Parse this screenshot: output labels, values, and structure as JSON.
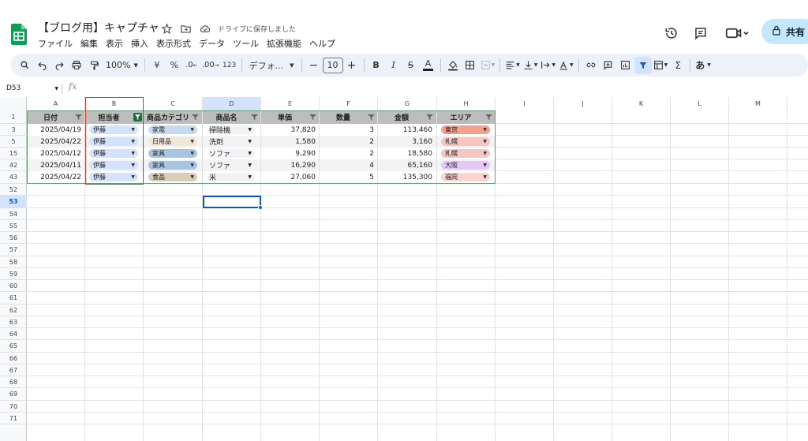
{
  "header": {
    "title": "【ブログ用】キャプチャ",
    "saved_status": "ドライブに保存しました",
    "share_label": "共有",
    "menu": [
      "ファイル",
      "編集",
      "表示",
      "挿入",
      "表示形式",
      "データ",
      "ツール",
      "拡張機能",
      "ヘルプ"
    ],
    "icons": [
      "star-icon",
      "move-to-folder-icon",
      "cloud-saved-icon",
      "history-icon",
      "comments-icon",
      "meet-icon",
      "lock-icon"
    ]
  },
  "toolbar": {
    "zoom": "100%",
    "currency": "¥",
    "percent": "%",
    "decrease_decimal": ".0",
    "increase_decimal": ".00",
    "number_format": "123",
    "font_family": "デフォ...",
    "font_size": "10",
    "ime": "あ"
  },
  "formula_bar": {
    "cell_ref": "D53",
    "fx": "fx",
    "value": ""
  },
  "grid": {
    "columns": [
      "A",
      "B",
      "C",
      "D",
      "E",
      "F",
      "G",
      "H",
      "I",
      "J",
      "K",
      "L",
      "M"
    ],
    "row_numbers": [
      "1",
      "3",
      "5",
      "15",
      "42",
      "43",
      "52",
      "53",
      "54",
      "55",
      "56",
      "57",
      "58",
      "59",
      "60",
      "61",
      "62",
      "63",
      "64",
      "65",
      "66",
      "67",
      "68",
      "69",
      "70",
      "71"
    ]
  },
  "table": {
    "headers": [
      "日付",
      "担当者",
      "商品カテゴリ",
      "商品名",
      "単価",
      "数量",
      "金額",
      "エリア"
    ],
    "rows": [
      {
        "date": "2025/04/19",
        "person": "伊藤",
        "category": "家電",
        "product": "掃除機",
        "price": "37,820",
        "qty": "3",
        "amount": "113,460",
        "area": "東京"
      },
      {
        "date": "2025/04/22",
        "person": "伊藤",
        "category": "日用品",
        "product": "洗剤",
        "price": "1,580",
        "qty": "2",
        "amount": "3,160",
        "area": "札幌"
      },
      {
        "date": "2025/04/12",
        "person": "伊藤",
        "category": "家具",
        "product": "ソファ",
        "price": "9,290",
        "qty": "2",
        "amount": "18,580",
        "area": "札幌"
      },
      {
        "date": "2025/04/11",
        "person": "伊藤",
        "category": "家具",
        "product": "ソファ",
        "price": "16,290",
        "qty": "4",
        "amount": "65,160",
        "area": "大阪"
      },
      {
        "date": "2025/04/22",
        "person": "伊藤",
        "category": "食品",
        "product": "米",
        "price": "27,060",
        "qty": "5",
        "amount": "135,300",
        "area": "福岡"
      }
    ],
    "colors": {
      "person_chip": "#d3e3fd",
      "category": {
        "家電": "#c6dbef",
        "日用品": "#efe7dc",
        "家具": "#a9c4e0",
        "食品": "#d9cdb8"
      },
      "area": {
        "東京": "#f4a08c",
        "札幌": "#f5c6c2",
        "大阪": "#e1c8f5",
        "福岡": "#fbd3d0"
      },
      "filter_active": "#137333",
      "selection_border": "#d93025",
      "active_cell": "#0b57d0"
    }
  }
}
